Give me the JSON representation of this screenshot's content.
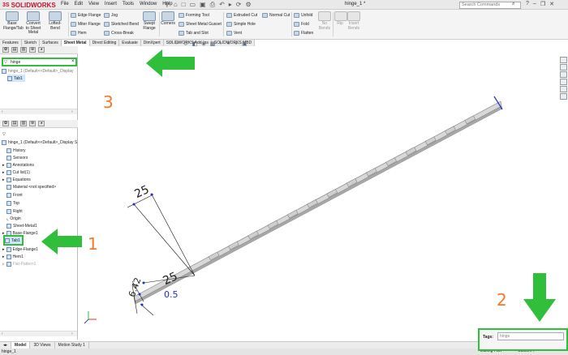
{
  "app": {
    "logo_text": "SOLIDWORKS",
    "document_title": "hinge_1 *",
    "search_placeholder": "Search Commands",
    "menu": [
      "File",
      "Edit",
      "View",
      "Insert",
      "Tools",
      "Window",
      "Help"
    ]
  },
  "ribbon": {
    "base_flange": "Base Flange/Tab",
    "convert_to_sheet_metal": "Convert to Sheet Metal",
    "lofted_bend": "Lofted-Bend",
    "edge_flange": "Edge Flange",
    "miter_flange": "Miter Flange",
    "hem": "Hem",
    "jog": "Jog",
    "sketched_bend": "Sketched Bend",
    "cross_break": "Cross-Break",
    "swept_flange": "Swept Flange",
    "corners": "Corners",
    "forming_tool": "Forming Tool",
    "sheet_metal_gusset": "Sheet Metal Gusset",
    "tab_and_slot": "Tab and Slot",
    "extruded_cut": "Extruded Cut",
    "simple_hole": "Simple Hole",
    "vent": "Vent",
    "normal_cut": "Normal Cut",
    "unfold": "Unfold",
    "fold": "Fold",
    "flatten": "Flatten",
    "no_bends": "No Bends",
    "rip": "Rip",
    "insert_bends": "Insert Bends"
  },
  "command_tabs": [
    "Features",
    "Sketch",
    "Surfaces",
    "Sheet Metal",
    "Direct Editing",
    "Evaluate",
    "DimXpert",
    "SOLIDWORKS Add-Ins",
    "SOLIDWORKS MBD"
  ],
  "feature_filter": {
    "value": "hinge",
    "clear_icon": "×",
    "result_root": "hinge_1 (Default<<Default>_Display",
    "result_item": "Tab1"
  },
  "feature_tree": {
    "root": "hinge_1 (Default<<Default>_Display S",
    "items": [
      {
        "label": "History"
      },
      {
        "label": "Sensors"
      },
      {
        "label": "Annotations"
      },
      {
        "label": "Cut list(1)"
      },
      {
        "label": "Equations"
      },
      {
        "label": "Material <not specified>"
      },
      {
        "label": "Front"
      },
      {
        "label": "Top"
      },
      {
        "label": "Right"
      },
      {
        "label": "Origin"
      },
      {
        "label": "Sheet-Metal1"
      },
      {
        "label": "Base-Flange1"
      },
      {
        "label": "Tab1"
      },
      {
        "label": "Edge-Flange1"
      },
      {
        "label": "Hem1"
      },
      {
        "label": "Flat-Pattern1"
      }
    ]
  },
  "dimensions": {
    "d1": "25",
    "d2": "25",
    "d3": "6.42",
    "d4": "0.5"
  },
  "annotations": {
    "n1": "1",
    "n2": "2",
    "n3": "3"
  },
  "bottom_tabs": [
    "Model",
    "3D Views",
    "Motion Study 1"
  ],
  "status": {
    "left": "hinge_1",
    "editing": "Editing Part",
    "units": "Custom"
  },
  "tags": {
    "label": "Tags:",
    "placeholder": "hinge"
  },
  "colors": {
    "highlight_green": "#2fbf3a",
    "annotation_orange": "#f07a2a",
    "selection_blue": "#cfe5fb"
  }
}
